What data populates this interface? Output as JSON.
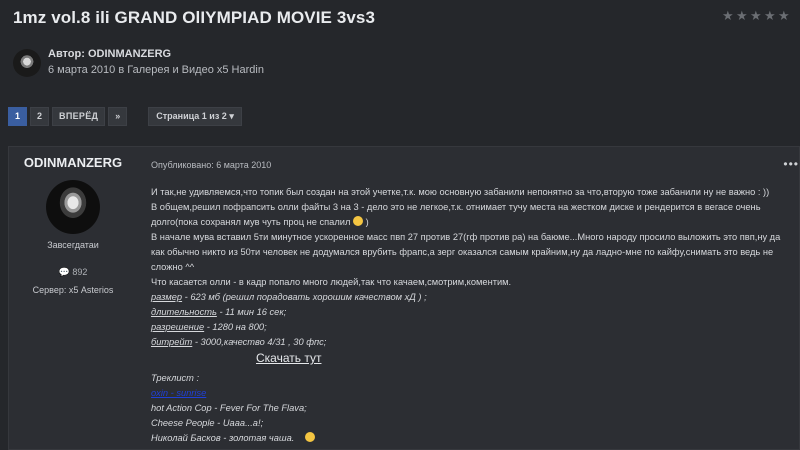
{
  "topic": {
    "title": "1mz vol.8 ili GRAND OlIYMPIAD MOVIE 3vs3",
    "author_label": "Автор:",
    "author_name": "ODINMANZERG",
    "date_line": "6 марта 2010 в Галерея и Видео х5 Hardin"
  },
  "rating": {
    "stars": 5,
    "filled": 0,
    "color": "#6b6e73"
  },
  "pagination": {
    "pages": [
      "1",
      "2"
    ],
    "active_page": "1",
    "next_label": "ВПЕРЁД",
    "last_label": "»",
    "page_select_label": "Страница 1 из 2"
  },
  "post": {
    "author_name": "ODINMANZERG",
    "rank": "Завсегдатаи",
    "posts_count": "892",
    "server": "Сервер: х5 Asterios",
    "posted": "Опубликовано: 6 марта 2010",
    "more_label": "•••",
    "lines": [
      "И так,не удивляемся,что топик был создан на этой учетке,т.к. мою основную забанили непонятно за что,вторую тоже забанили ну не важно : ))",
      "В общем,решил пофрапсить олли файты 3 на 3 - дело это не легкое,т.к. отнимает тучу места на жестком диске и рендерится в вегасе очень",
      "долго(пока сохранял мув чуть проц не спалил",
      "В начале мува вставил 5ти минутное ускоренное масс пвп 27 против 27(гф против ра) на баюме...Много народу просило выложить это пвп,ну да",
      "как обычно никто из 50ти человек не додумался врубить фрапс,а зерг оказался самым крайним,ну да ладно-мне по кайфу,снимать это ведь не",
      "сложно ^^",
      "Что касается олли - в кадр попало много людей,так что качаем,смотрим,коментим."
    ],
    "line3_after": ")",
    "specs": [
      {
        "label": "размер",
        "value": " - 623 мб (решил порадовать хорошим качеством хД ) ;"
      },
      {
        "label": "длительность",
        "value": " - 11 мин 16 сек;"
      },
      {
        "label": "разрешение",
        "value": " - 1280 на 800;"
      },
      {
        "label": "битрейт",
        "value": " - 3000,качество 4/31 , 30 фпс;"
      }
    ],
    "download_label": "Скачать тут",
    "tracklist_title": "Треклист :",
    "tracklist_link": "oxin - sunrise",
    "tracks": [
      "hot Action Cop - Fever For The Flava;",
      "Cheese People - Uaaa...a!;",
      "Николай Басков - золотая чаша."
    ]
  },
  "colors": {
    "background": "#25272b",
    "card": "#2c2e33",
    "active_page": "#3a5ea0",
    "link_blue": "#1f3fd8"
  }
}
